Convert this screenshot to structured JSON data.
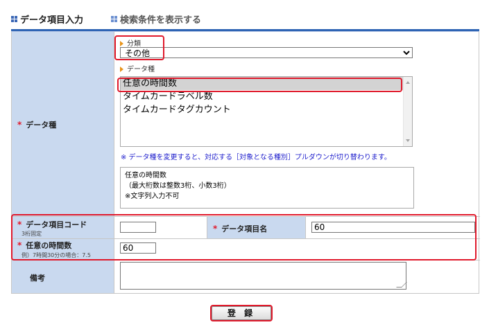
{
  "header": {
    "tab_entry": "データ項目入力",
    "tab_search": "検索条件を表示する"
  },
  "form": {
    "required_mark": "*",
    "category": {
      "label": "分類",
      "selected": "その他"
    },
    "data_type": {
      "row_label": "データ種",
      "sub_label": "データ種",
      "options": [
        "任意の時間数",
        "タイムカードラベル数",
        "タイムカードタグカウント"
      ],
      "selected_index": 0,
      "note": "※ データ種を変更すると、対応する［対象となる種別］プルダウンが切り替わります。",
      "description_lines": [
        "任意の時間数",
        "（最大桁数は整数3桁、小数3桁）",
        "※文字列入力不可"
      ]
    },
    "code": {
      "label": "データ項目コード",
      "sub": "3桁固定",
      "value": ""
    },
    "name": {
      "label": "データ項目名",
      "value": "60"
    },
    "hours": {
      "label": "任意の時間数",
      "sub": "例）7時間30分の場合：7.5",
      "value": "60"
    },
    "remarks": {
      "label": "備考",
      "value": ""
    }
  },
  "actions": {
    "register_label": "登 録"
  }
}
